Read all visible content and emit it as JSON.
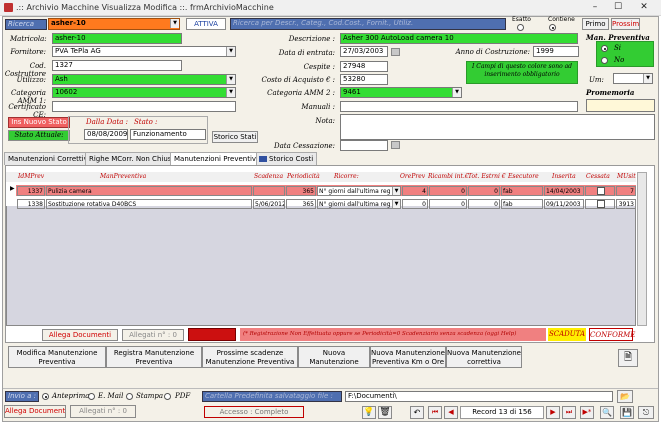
{
  "window": {
    "title": ".:: Archivio Macchine Visualizza Modifica ::.   frmArchivioMacchine",
    "min": "–",
    "max": "☐",
    "close": "✕"
  },
  "topbar": {
    "search_label": "Ricerca",
    "search_value": "asher-10",
    "status": "ATTIVA",
    "hint": "Ricerca per Descr., Categ., Cod.Cost., Fornit., Utiliz.",
    "exact_label": "Esatto",
    "contains_label": "Contiene",
    "first": "Primo",
    "next": "Prossimo"
  },
  "form": {
    "matricola_label": "Matricola:",
    "matricola": "asher-10",
    "fornitore_label": "Fornitore:",
    "fornitore": "PVA TePla AG",
    "codcost_label": "Cod. Costruttore",
    "codcost": "1327",
    "utilizzo_label": "Utilizzo:",
    "utilizzo": "Ash",
    "catamm1_label": "Categoria AMM 1:",
    "catamm1": "10602",
    "certce_label": "Certificato CE:",
    "certce": "",
    "desc_label": "Descrizione :",
    "desc": "Asher 300 AutoLoad camera 10",
    "dataentrata_label": "Data di entrata:",
    "dataentrata": "27/03/2003",
    "anno_label": "Anno di Costruzione:",
    "anno": "1999",
    "cespite_label": "Cespite :",
    "cespite": "27948",
    "costo_label": "Costo di Acquisto € :",
    "costo": "53280",
    "catamm2_label": "Categoria AMM 2 :",
    "catamm2": "9461",
    "manuali_label": "Manuali :",
    "nota_label": "Nota:",
    "datacess_label": "Data Cessazione:",
    "info": "I Campi di questo colore sono ad inserimento obbligatorio",
    "manprev_label": "Man. Preventiva",
    "si": "Si",
    "no": "No",
    "um_label": "Um:",
    "promemoria": "Promemoria",
    "insstato": "Ins Nuovo Stato",
    "statoattuale": "Stato Attuale:",
    "dalladata_label": "Dalla Data :",
    "stato_label": "Stato :",
    "dalladata": "08/08/2009",
    "stato": "Funzionamento",
    "storicostati": "Storico Stati"
  },
  "tabs": [
    "Manutenzioni Correttive",
    "Righe MCorr. Non Chiuse",
    "Manutenzioni Preventive",
    "Storico Costi"
  ],
  "grid": {
    "headers": [
      "IdMPrev",
      "ManPreventiva",
      "Scadenza",
      "Periodicità",
      "Ricorre:",
      "OrePrev",
      "Ricambi int.€",
      "Tot. Estrni €",
      "Esecutore",
      "Inserita",
      "Cessata",
      "MUsit"
    ],
    "rows": [
      [
        "1337",
        "Pulizia camera",
        "",
        "365",
        "N° giorni dall'ultima reg",
        "4",
        "0",
        "0",
        "fab",
        "14/04/2003",
        "",
        "7"
      ],
      [
        "1338",
        "Sostituzione rotativa D40BCS",
        "5/06/2012",
        "365",
        "N° giorni dall'ultima reg",
        "0",
        "0",
        "0",
        "fab",
        "09/11/2003",
        "",
        "3913"
      ]
    ]
  },
  "legend": {
    "allega": "Allega Documenti",
    "allegati": "Allegati n° : 0",
    "desc": "(* Registrazione Non Effettuata oppure  se Periodicità=0  Scadenziario senza scadenza (oggi Help)",
    "scaduta": "SCADUTA",
    "conforme": "CONFORME"
  },
  "actions": [
    "Modifica Manutenzione Preventiva",
    "Registra Manutenzione Preventiva",
    "Prossime scadenze Manutenzione Preventiva",
    "Nuova Manutenzione Preventiva",
    "Nuova Manutenzione Preventiva Km o Ore",
    "Nuova Manutenzione correttiva"
  ],
  "bottom": {
    "print_label": "Invio a :",
    "anteprima": "Anteprima",
    "email": "E. Mail",
    "stampa": "Stampa",
    "pdf": "PDF",
    "cartella_label": "Cartella Predefinita salvataggio file :",
    "cartella": "F:\\Documenti\\",
    "allega": "Allega Documenti",
    "allegati": "Allegati n° : 0",
    "accesso": "Accesso : Completo",
    "record": "Record 13 di 156"
  }
}
